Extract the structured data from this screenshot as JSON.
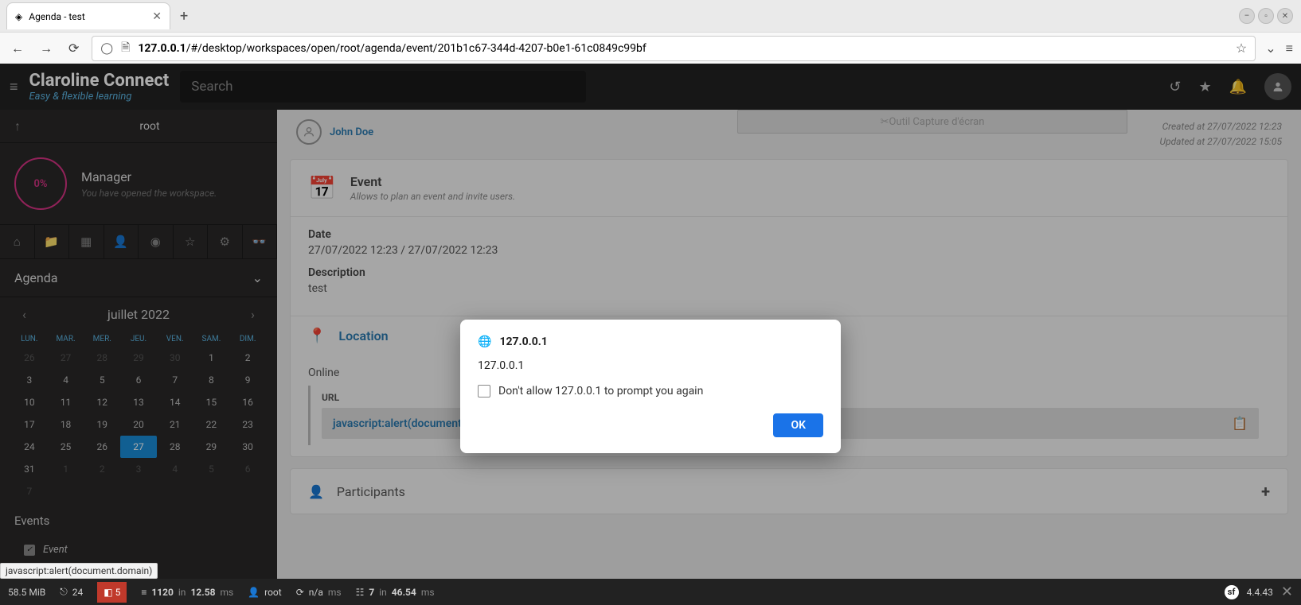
{
  "browser": {
    "tab_title": "Agenda - test",
    "url_host": "127.0.0.1",
    "url_path": "/#/desktop/workspaces/open/root/agenda/event/201b1c67-344d-4207-b0e1-61c0849c99bf"
  },
  "header": {
    "brand": "Claroline Connect",
    "tagline": "Easy & flexible learning",
    "search_placeholder": "Search"
  },
  "sidebar": {
    "root_label": "root",
    "progress_pct": "0%",
    "role": "Manager",
    "role_sub": "You have opened the workspace.",
    "agenda_label": "Agenda",
    "cal_month": "juillet 2022",
    "dow": [
      "LUN.",
      "MAR.",
      "MER.",
      "JEU.",
      "VEN.",
      "SAM.",
      "DIM."
    ],
    "events_title": "Events",
    "event_filter": "Event"
  },
  "meta": {
    "author": "John Doe",
    "created": "Created at 27/07/2022 12:23",
    "updated": "Updated at 27/07/2022 15:05"
  },
  "event": {
    "title": "Event",
    "subtitle": "Allows to plan an event and invite users.",
    "date_label": "Date",
    "date_value": "27/07/2022 12:23 / 27/07/2022 12:23",
    "desc_label": "Description",
    "desc_value": "test",
    "location_label": "Location",
    "online_label": "Online",
    "url_label": "URL",
    "url_value": "javascript:alert(document.domain)",
    "participants_label": "Participants"
  },
  "capture_tool": "Outil Capture d'écran",
  "dialog": {
    "host": "127.0.0.1",
    "message": "127.0.0.1",
    "checkbox": "Don't allow 127.0.0.1 to prompt you again",
    "ok": "OK"
  },
  "debug": {
    "mem": "58.5 MiB",
    "q1": "24",
    "q2": "5",
    "q3": "1120",
    "q3t": "12.58",
    "user": "root",
    "na": "n/a",
    "q4": "7",
    "q4t": "46.54",
    "ver": "4.4.43"
  },
  "hover": "javascript:alert(document.domain)"
}
